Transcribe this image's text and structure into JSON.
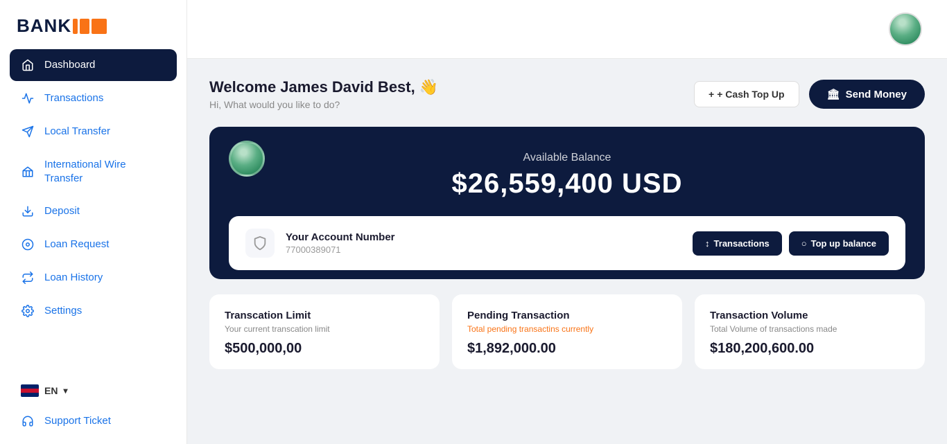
{
  "logo": {
    "text": "BANK"
  },
  "sidebar": {
    "items": [
      {
        "id": "dashboard",
        "label": "Dashboard",
        "icon": "home",
        "active": true
      },
      {
        "id": "transactions",
        "label": "Transactions",
        "icon": "activity"
      },
      {
        "id": "local-transfer",
        "label": "Local Transfer",
        "icon": "send"
      },
      {
        "id": "international-wire",
        "label": "International Wire Transfer",
        "icon": "building"
      },
      {
        "id": "deposit",
        "label": "Deposit",
        "icon": "download"
      },
      {
        "id": "loan-request",
        "label": "Loan Request",
        "icon": "disc"
      },
      {
        "id": "loan-history",
        "label": "Loan History",
        "icon": "repeat"
      },
      {
        "id": "settings",
        "label": "Settings",
        "icon": "settings"
      }
    ],
    "support": "Support Ticket",
    "language": "EN"
  },
  "topbar": {
    "avatar_alt": "User avatar"
  },
  "welcome": {
    "greeting": "Welcome James David Best,",
    "emoji": "👋",
    "subtitle": "Hi, What would you like to do?"
  },
  "actions": {
    "cash_topup": "+ Cash Top Up",
    "send_money": "Send Money",
    "send_money_icon": "🏛"
  },
  "balance_card": {
    "label": "Available Balance",
    "amount": "$26,559,400 USD"
  },
  "account": {
    "title": "Your Account Number",
    "number": "77000389071",
    "btn_transactions": "Transactions",
    "btn_topup": "Top up balance",
    "transactions_icon": "↕",
    "topup_icon": "○"
  },
  "stats": [
    {
      "title": "Transcation Limit",
      "subtitle": "Your current transcation limit",
      "value": "$500,000,00",
      "subtitle_class": "normal"
    },
    {
      "title": "Pending Transaction",
      "subtitle": "Total pending transactins currently",
      "value": "$1,892,000.00",
      "subtitle_class": "pending"
    },
    {
      "title": "Transaction Volume",
      "subtitle": "Total Volume of transactions made",
      "value": "$180,200,600.00",
      "subtitle_class": "normal"
    }
  ]
}
